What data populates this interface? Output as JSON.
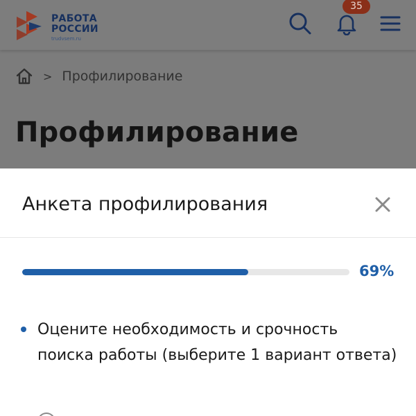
{
  "header": {
    "logo_line1": "РАБОТА",
    "logo_line2": "РОССИИ",
    "logo_domain": "trudvsem.ru",
    "notification_count": "35",
    "icons": {
      "search": "search-icon",
      "bell": "bell-icon",
      "menu": "menu-icon",
      "home": "home-icon"
    }
  },
  "breadcrumb": {
    "separator": ">",
    "current": "Профилирование"
  },
  "page": {
    "title": "Профилирование"
  },
  "modal": {
    "title": "Анкета профилирования",
    "close_icon": "close-icon",
    "progress": {
      "percent_value": 69,
      "label": "69%"
    },
    "question": "Оцените необходимость и срочность поиска работы (выберите 1 вариант ответа)"
  },
  "colors": {
    "accent_blue": "#1f5fa8",
    "logo_navy": "#17305e",
    "badge_bg": "#8a2f19",
    "logo_red": "#a43a22"
  }
}
